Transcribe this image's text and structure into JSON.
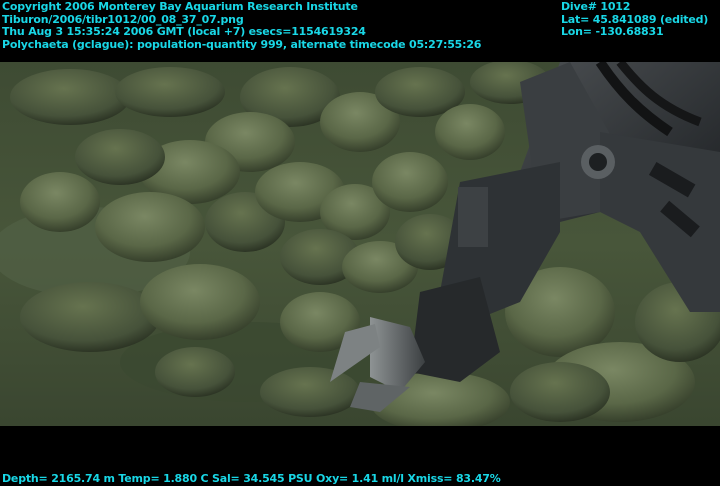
{
  "header": {
    "copyright": "Copyright 2006 Monterey Bay Aquarium Research Institute",
    "file_path": "Tiburon/2006/tibr1012/00_08_37_07.png",
    "timestamp": "Thu Aug  3 15:35:24 2006 GMT (local +7)  esecs=1154619324",
    "annotation": "Polychaeta (gclague): population-quantity 999, alternate timecode 05:27:55:26"
  },
  "nav": {
    "dive": "Dive# 1012",
    "lat": "Lat= 45.841089 (edited)",
    "lon": "Lon= -130.68831"
  },
  "footer": {
    "telemetry": "Depth= 2165.74 m  Temp= 1.880 C  Sal= 34.545 PSU  Oxy= 1.41 ml/l  Xmiss= 83.47%"
  },
  "colors": {
    "overlay_text": "#19d7e6",
    "seafloor": "#4b5a3c",
    "rock": "#5d6a4a",
    "arm": "#2a2d30"
  }
}
